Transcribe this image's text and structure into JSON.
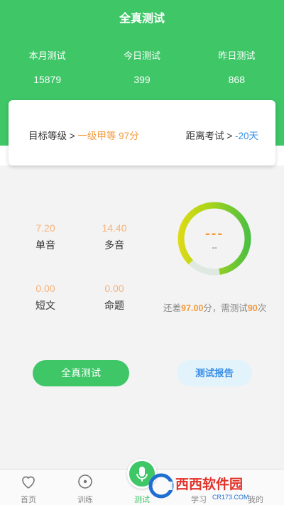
{
  "header": {
    "title": "全真测试",
    "stats": [
      {
        "label": "本月测试",
        "value": "15879"
      },
      {
        "label": "今日测试",
        "value": "399"
      },
      {
        "label": "昨日测试",
        "value": "868"
      }
    ]
  },
  "target": {
    "level_label": "目标等级 >",
    "level_value": "一级甲等 97分",
    "exam_label": "距离考试 >",
    "exam_value": "-20天"
  },
  "scores": [
    {
      "value": "7.20",
      "name": "单音"
    },
    {
      "value": "14.40",
      "name": "多音"
    },
    {
      "value": "0.00",
      "name": "短文"
    },
    {
      "value": "0.00",
      "name": "命题"
    }
  ],
  "ring": {
    "main": "---",
    "sub": "--",
    "progress_fraction": 0.85
  },
  "remain": {
    "p1": "还差",
    "points": "97.00",
    "p2": "分，需测试",
    "times": "90",
    "p3": "次"
  },
  "buttons": {
    "full_test": "全真测试",
    "report": "测试报告"
  },
  "tabs": [
    {
      "label": "首页",
      "icon": "heart-icon"
    },
    {
      "label": "训练",
      "icon": "target-icon"
    },
    {
      "label": "测试",
      "icon": "microphone-icon"
    },
    {
      "label": "学习",
      "icon": "book-icon"
    },
    {
      "label": "我的",
      "icon": "user-icon"
    }
  ],
  "watermark": {
    "brand": "西西软件园",
    "url": "CR173.COM"
  },
  "colors": {
    "primary_green": "#3ec667",
    "accent_orange": "#f39a3b",
    "accent_blue": "#3a8ee6"
  }
}
